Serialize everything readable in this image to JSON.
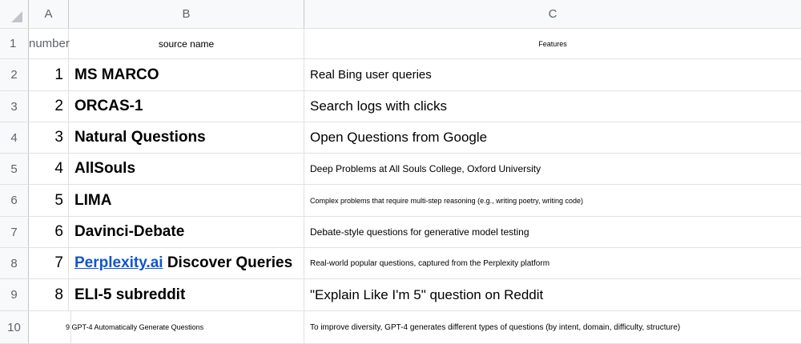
{
  "column_headers": [
    "A",
    "B",
    "C"
  ],
  "header_row": {
    "row_number": "1",
    "a": "number",
    "b": "source name",
    "c": "Features"
  },
  "rows": [
    {
      "row": "2",
      "num": "1",
      "source": "MS MARCO",
      "features": "Real Bing user queries"
    },
    {
      "row": "3",
      "num": "2",
      "source": "ORCAS-1",
      "features": "Search logs with clicks"
    },
    {
      "row": "4",
      "num": "3",
      "source": "Natural Questions",
      "features": "Open Questions from Google"
    },
    {
      "row": "5",
      "num": "4",
      "source": "AllSouls",
      "features": "Deep Problems at All Souls College, Oxford University"
    },
    {
      "row": "6",
      "num": "5",
      "source": "LIMA",
      "features": "Complex problems that require multi-step reasoning (e.g., writing poetry, writing code)"
    },
    {
      "row": "7",
      "num": "6",
      "source": "Davinci-Debate",
      "features": "Debate-style questions for generative model testing"
    },
    {
      "row": "8",
      "num": "7",
      "source_link": "Perplexity.ai",
      "source_rest": " Discover Queries",
      "features": "Real-world popular questions, captured from the Perplexity platform"
    },
    {
      "row": "9",
      "num": "8",
      "source": "ELI-5 subreddit",
      "features": "\"Explain Like I'm 5\" question on Reddit"
    },
    {
      "row": "10",
      "num": "9",
      "source": "GPT-4 Automatically Generate Questions",
      "features": "To improve diversity, GPT-4 generates different types of questions (by intent, domain, difficulty, structure)"
    }
  ],
  "colors": {
    "link": "#1155cc",
    "header_bg": "#f8f9fa",
    "grid": "#e1e1e1"
  }
}
